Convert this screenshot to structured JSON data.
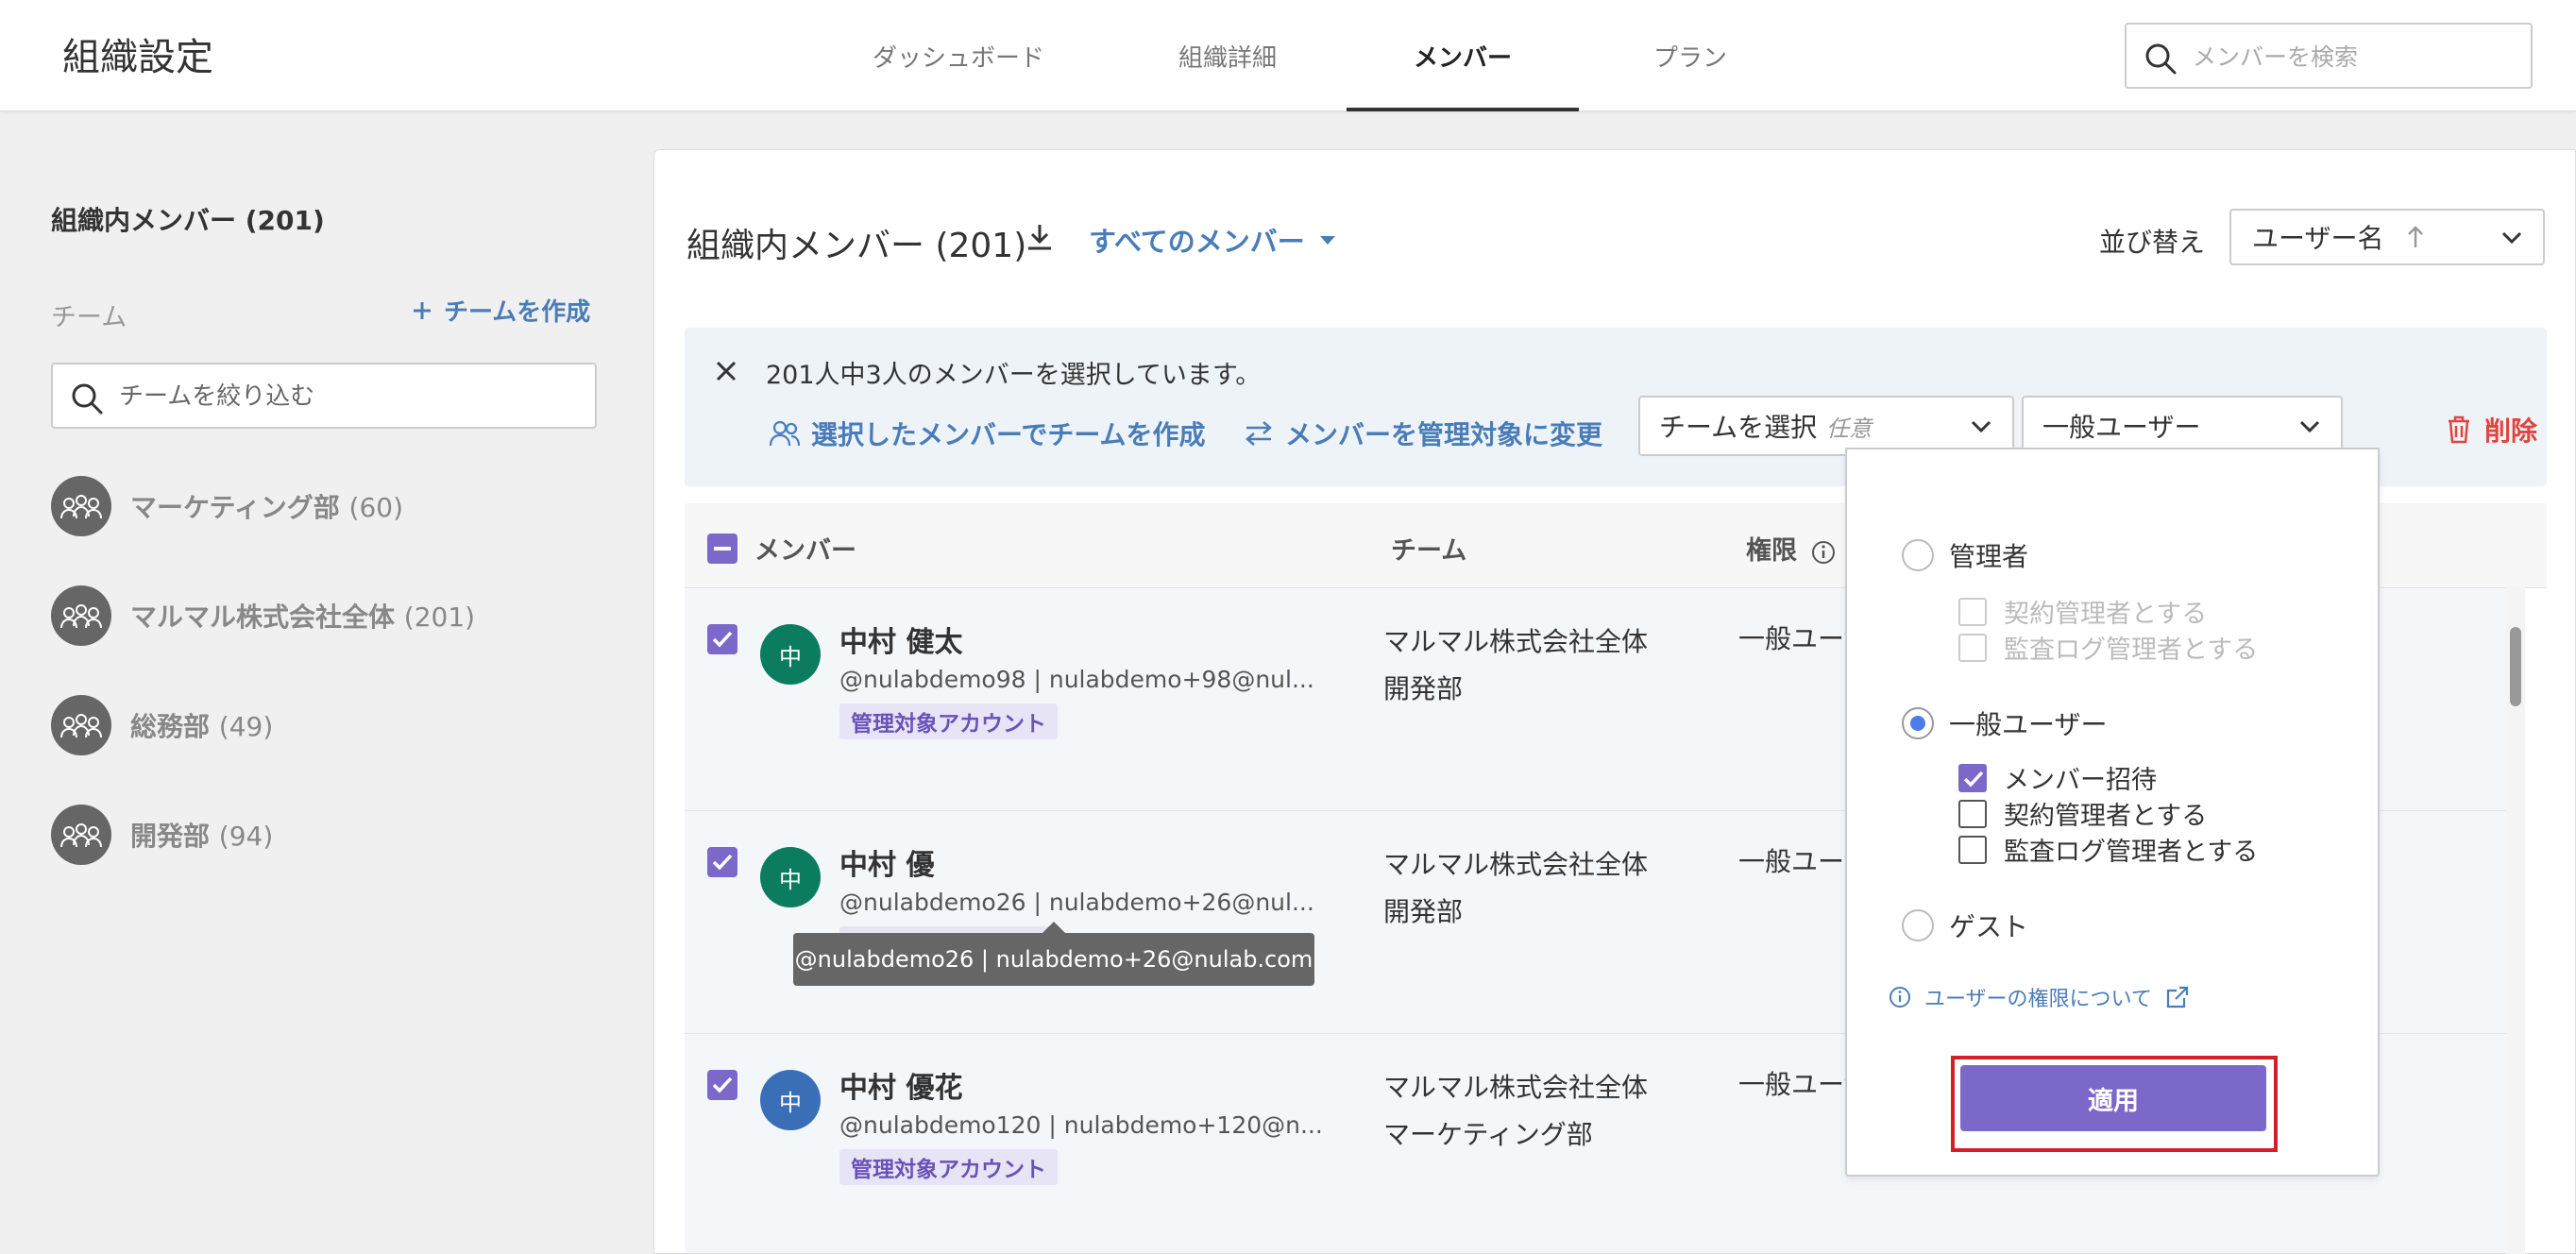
{
  "header": {
    "title": "組織設定",
    "tabs": [
      {
        "label": "ダッシュボード"
      },
      {
        "label": "組織詳細"
      },
      {
        "label": "メンバー"
      },
      {
        "label": "プラン"
      }
    ],
    "search_placeholder": "メンバーを検索"
  },
  "sidebar": {
    "title": "組織内メンバー (201)",
    "team_label": "チーム",
    "create_team": "チームを作成",
    "filter_placeholder": "チームを絞り込む",
    "teams": [
      {
        "name": "マーケティング部",
        "count": "(60)"
      },
      {
        "name": "マルマル株式会社全体",
        "count": "(201)"
      },
      {
        "name": "総務部",
        "count": "(49)"
      },
      {
        "name": "開発部",
        "count": "(94)"
      }
    ]
  },
  "main": {
    "title": "組織内メンバー (201)",
    "member_filter": "すべてのメンバー",
    "sort_label": "並び替え",
    "sort_value": "ユーザー名",
    "selection": {
      "text": "201人中3人のメンバーを選択しています。",
      "create_team_action": "選択したメンバーでチームを作成",
      "manage_action": "メンバーを管理対象に変更",
      "team_select": "チームを選択",
      "team_select_optional": "任意",
      "role_select": "一般ユーザー",
      "delete": "削除"
    },
    "columns": {
      "member": "メンバー",
      "team": "チーム",
      "role": "権限"
    },
    "rows": [
      {
        "initial": "中",
        "name": "中村 健太",
        "handle": "@nulabdemo98 | nulabdemo+98@nul...",
        "badge": "管理対象アカウント",
        "team1": "マルマル株式会社全体",
        "team2": "開発部",
        "role": "一般ユーザ"
      },
      {
        "initial": "中",
        "name": "中村 優",
        "handle": "@nulabdemo26 | nulabdemo+26@nul...",
        "badge": "管理対象アカウント",
        "team1": "マルマル株式会社全体",
        "team2": "開発部",
        "role": "一般ユーザ"
      },
      {
        "initial": "中",
        "name": "中村 優花",
        "handle": "@nulabdemo120 | nulabdemo+120@n...",
        "badge": "管理対象アカウント",
        "team1": "マルマル株式会社全体",
        "team2": "マーケティング部",
        "role": "一般ユーザ"
      }
    ],
    "tooltip": "@nulabdemo26 | nulabdemo+26@nulab.com"
  },
  "role_panel": {
    "admin": "管理者",
    "admin_contract": "契約管理者とする",
    "admin_audit": "監査ログ管理者とする",
    "general": "一般ユーザー",
    "general_invite": "メンバー招待",
    "general_contract": "契約管理者とする",
    "general_audit": "監査ログ管理者とする",
    "guest": "ゲスト",
    "link": "ユーザーの権限について",
    "apply": "適用"
  },
  "colors": {
    "accent": "#7b68c8",
    "link": "#4a7db8",
    "danger": "#e0443e",
    "avatar_green": "#0b7d5e",
    "avatar_blue": "#3a6fb8"
  }
}
